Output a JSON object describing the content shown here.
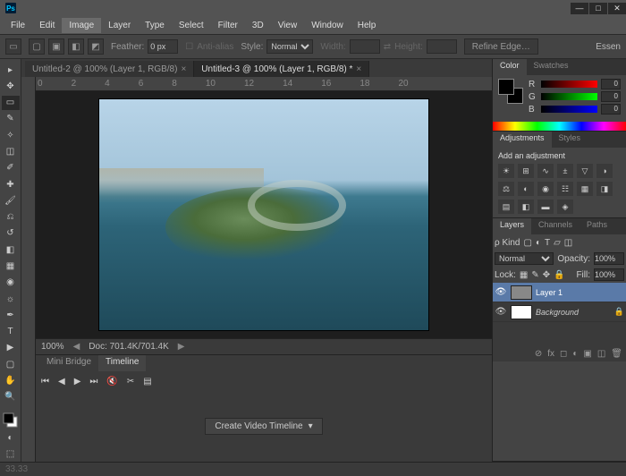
{
  "app": {
    "logo": "Ps"
  },
  "window_buttons": {
    "min": "—",
    "max": "□",
    "close": "✕"
  },
  "menu": [
    "File",
    "Edit",
    "Image",
    "Layer",
    "Type",
    "Select",
    "Filter",
    "3D",
    "View",
    "Window",
    "Help"
  ],
  "menu_active": "Image",
  "options": {
    "feather_label": "Feather:",
    "feather_value": "0 px",
    "antialias_label": "Anti-alias",
    "style_label": "Style:",
    "style_value": "Normal",
    "width_label": "Width:",
    "height_label": "Height:",
    "refine": "Refine Edge…",
    "workspace": "Essen"
  },
  "doc_tabs": [
    {
      "label": "Untitled-2 @ 100% (Layer 1, RGB/8)",
      "active": false
    },
    {
      "label": "Untitled-3 @ 100% (Layer 1, RGB/8) *",
      "active": true
    }
  ],
  "ruler_marks": [
    "0",
    "2",
    "4",
    "6",
    "8",
    "10",
    "12",
    "14",
    "16",
    "18",
    "20"
  ],
  "status": {
    "zoom": "100%",
    "doc": "Doc: 701.4K/701.4K"
  },
  "bottom_panel": {
    "tabs": [
      "Mini Bridge",
      "Timeline"
    ],
    "active": "Timeline",
    "button": "Create Video Timeline"
  },
  "color_panel": {
    "tabs": [
      "Color",
      "Swatches"
    ],
    "active": "Color",
    "channels": [
      {
        "label": "R",
        "value": "0"
      },
      {
        "label": "G",
        "value": "0"
      },
      {
        "label": "B",
        "value": "0"
      }
    ]
  },
  "adjustments_panel": {
    "tabs": [
      "Adjustments",
      "Styles"
    ],
    "active": "Adjustments",
    "title": "Add an adjustment"
  },
  "layers_panel": {
    "tabs": [
      "Layers",
      "Channels",
      "Paths"
    ],
    "active": "Layers",
    "kind_label": "ρ Kind",
    "blend": "Normal",
    "opacity_label": "Opacity:",
    "opacity_value": "100%",
    "lock_label": "Lock:",
    "fill_label": "Fill:",
    "fill_value": "100%",
    "layers": [
      {
        "name": "Layer 1",
        "selected": true,
        "locked": false
      },
      {
        "name": "Background",
        "selected": false,
        "locked": true,
        "italic": true
      }
    ]
  },
  "footer": {
    "size": "33.33"
  }
}
